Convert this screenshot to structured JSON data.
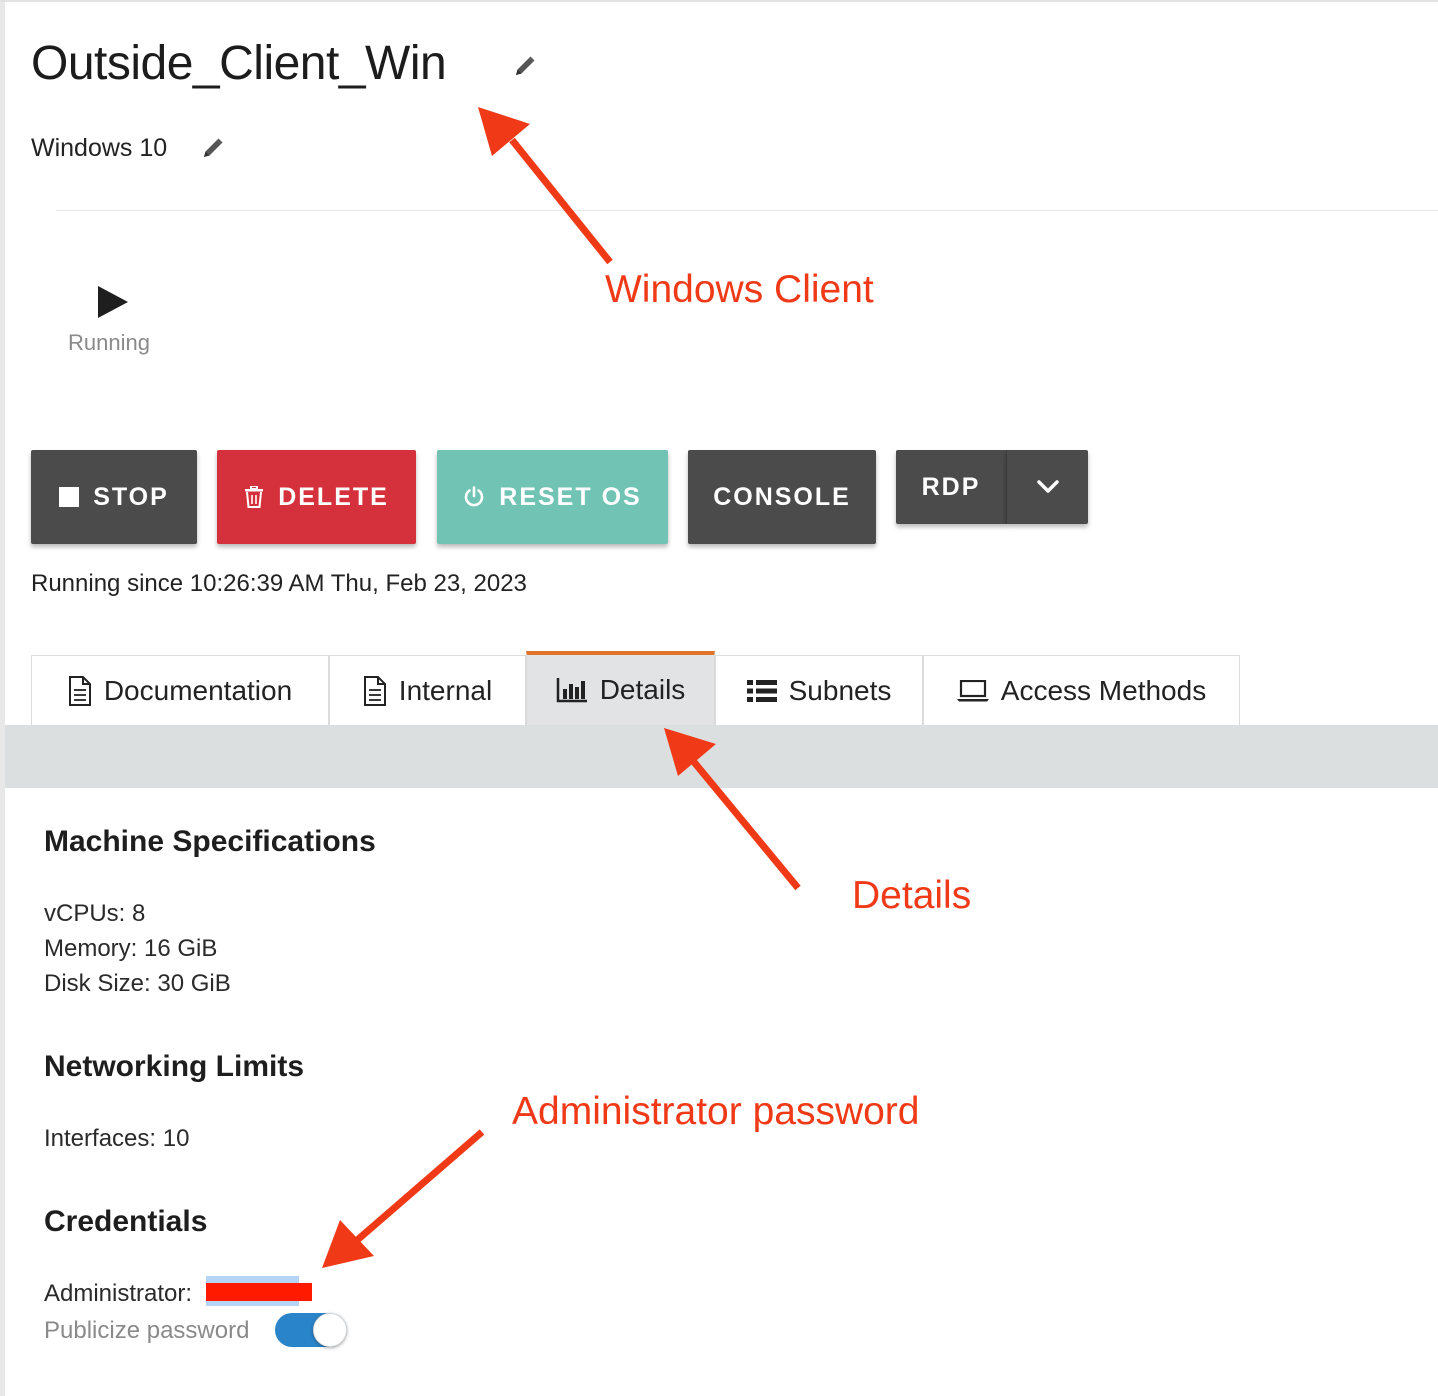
{
  "machine": {
    "name": "Outside_Client_Win",
    "os": "Windows 10",
    "status": "Running",
    "running_since": "Running since 10:26:39 AM Thu, Feb 23, 2023"
  },
  "actions": {
    "stop": "STOP",
    "delete": "DELETE",
    "reset_os": "RESET OS",
    "console": "CONSOLE",
    "rdp": "RDP"
  },
  "tabs": [
    {
      "label": "Documentation",
      "icon": "document-icon"
    },
    {
      "label": "Internal",
      "icon": "document-icon"
    },
    {
      "label": "Details",
      "icon": "bar-chart-icon",
      "active": true
    },
    {
      "label": "Subnets",
      "icon": "list-icon"
    },
    {
      "label": "Access Methods",
      "icon": "laptop-icon"
    }
  ],
  "details": {
    "specs_heading": "Machine Specifications",
    "vcpus": "vCPUs: 8",
    "memory": "Memory: 16 GiB",
    "disk": "Disk Size: 30 GiB",
    "net_heading": "Networking Limits",
    "interfaces": "Interfaces: 10",
    "cred_heading": "Credentials",
    "admin_label": "Administrator:",
    "publicize_label": "Publicize password",
    "publicize_on": true
  },
  "annotations": {
    "windows_client": "Windows Client",
    "details": "Details",
    "admin_password": "Administrator password"
  },
  "colors": {
    "accent_tab": "#e0742a",
    "delete": "#d5313d",
    "reset": "#71c3b3",
    "dark_button": "#4b4b4b",
    "toggle": "#2a84c9",
    "annotation": "#f03a17"
  }
}
